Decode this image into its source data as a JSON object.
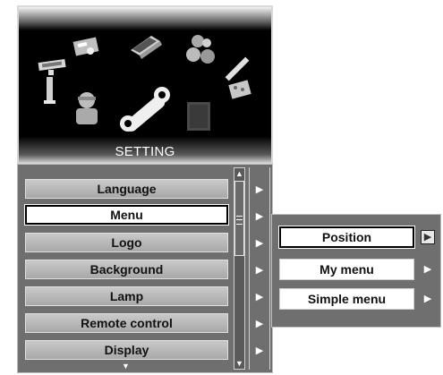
{
  "banner": {
    "title": "SETTING"
  },
  "menu": {
    "items": [
      {
        "label": "Language"
      },
      {
        "label": "Menu"
      },
      {
        "label": "Logo"
      },
      {
        "label": "Background"
      },
      {
        "label": "Lamp"
      },
      {
        "label": "Remote control"
      },
      {
        "label": "Display"
      }
    ],
    "selected": "Menu"
  },
  "submenu": {
    "items": [
      {
        "label": "Position"
      },
      {
        "label": "My menu"
      },
      {
        "label": "Simple menu"
      }
    ],
    "selected": "Position"
  },
  "glyphs": {
    "arrow_right": "▶",
    "arrow_up": "▲",
    "arrow_down": "▼",
    "more_down": "▼"
  },
  "colors": {
    "panel_bg": "#6f6f6f",
    "item_bg": "#b8b8b8",
    "selected_bg": "#ffffff",
    "banner_bg": "#000000"
  }
}
